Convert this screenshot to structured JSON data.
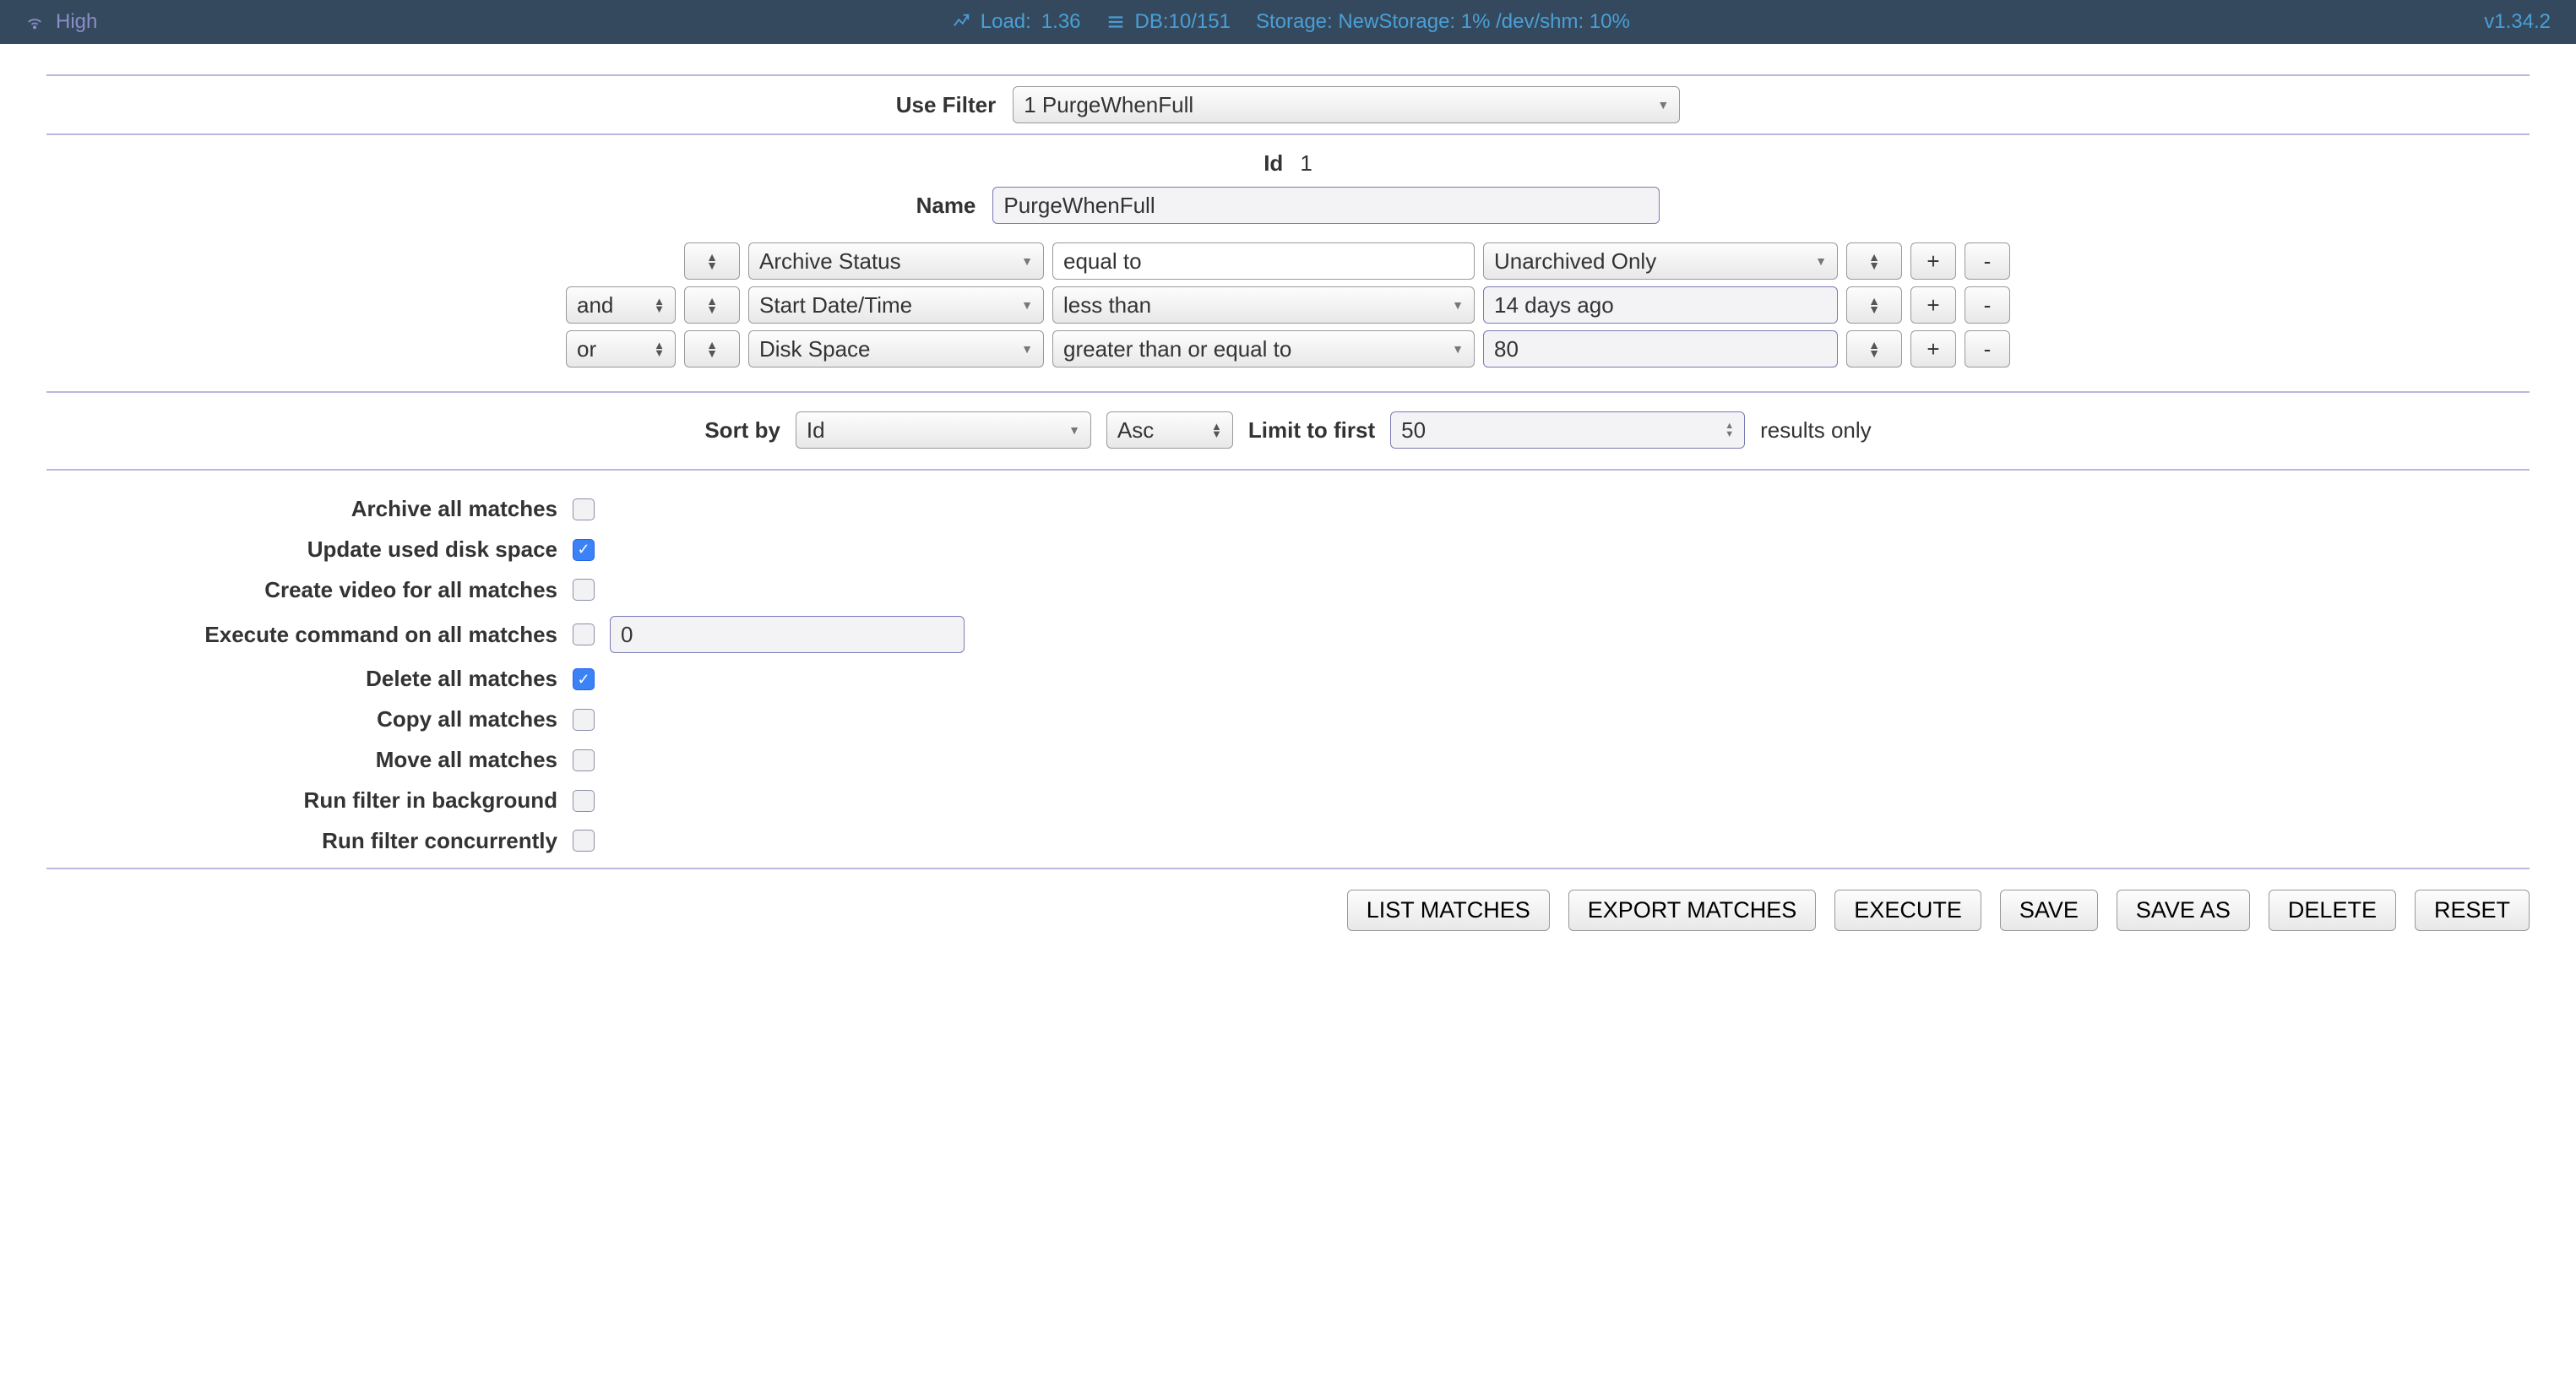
{
  "topbar": {
    "bandwidth": "High",
    "load_label": "Load:",
    "load_value": "1.36",
    "db_label": "DB:10/151",
    "storage_label": "Storage: NewStorage: 1% /dev/shm: 10%",
    "version": "v1.34.2"
  },
  "useFilter": {
    "label": "Use Filter",
    "value": "1 PurgeWhenFull"
  },
  "idRow": {
    "label": "Id",
    "value": "1"
  },
  "nameRow": {
    "label": "Name",
    "value": "PurgeWhenFull"
  },
  "conditions": [
    {
      "conj": "",
      "attr": "Archive Status",
      "op": "equal to",
      "val": "Unarchived Only",
      "val_is_select": true
    },
    {
      "conj": "and",
      "attr": "Start Date/Time",
      "op": "less than",
      "val": "14 days ago",
      "val_is_select": false
    },
    {
      "conj": "or",
      "attr": "Disk Space",
      "op": "greater than or equal to",
      "val": "80",
      "val_is_select": false
    }
  ],
  "sort": {
    "label": "Sort by",
    "field": "Id",
    "dir": "Asc",
    "limit_label": "Limit to first",
    "limit_value": "50",
    "limit_suffix": "results only"
  },
  "options": {
    "archive": {
      "label": "Archive all matches",
      "checked": false
    },
    "updateDisk": {
      "label": "Update used disk space",
      "checked": true
    },
    "createVideo": {
      "label": "Create video for all matches",
      "checked": false
    },
    "execCmd": {
      "label": "Execute command on all matches",
      "checked": false,
      "value": "0"
    },
    "deleteAll": {
      "label": "Delete all matches",
      "checked": true
    },
    "copyAll": {
      "label": "Copy all matches",
      "checked": false
    },
    "moveAll": {
      "label": "Move all matches",
      "checked": false
    },
    "background": {
      "label": "Run filter in background",
      "checked": false
    },
    "concurrent": {
      "label": "Run filter concurrently",
      "checked": false
    }
  },
  "actions": {
    "listMatches": "LIST MATCHES",
    "exportMatches": "EXPORT MATCHES",
    "execute": "EXECUTE",
    "save": "SAVE",
    "saveAs": "SAVE AS",
    "delete": "DELETE",
    "reset": "RESET"
  }
}
